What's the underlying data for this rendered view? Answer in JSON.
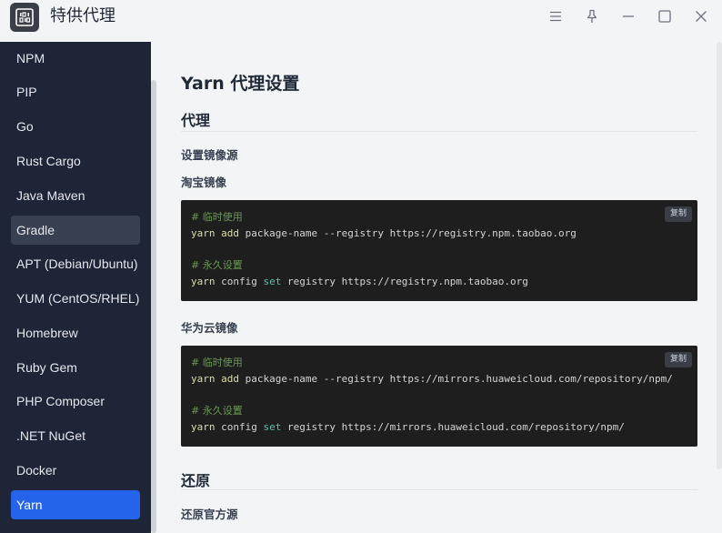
{
  "app": {
    "title": "特供代理"
  },
  "sidebar": {
    "items": [
      {
        "label": "NPM"
      },
      {
        "label": "PIP"
      },
      {
        "label": "Go"
      },
      {
        "label": "Rust Cargo"
      },
      {
        "label": "Java Maven"
      },
      {
        "label": "Gradle"
      },
      {
        "label": "APT (Debian/Ubuntu)"
      },
      {
        "label": "YUM (CentOS/RHEL)"
      },
      {
        "label": "Homebrew"
      },
      {
        "label": "Ruby Gem"
      },
      {
        "label": "PHP Composer"
      },
      {
        "label": ".NET NuGet"
      },
      {
        "label": "Docker"
      },
      {
        "label": "Yarn"
      }
    ],
    "hovered": "Gradle",
    "selected": "Yarn"
  },
  "main": {
    "page_title": "Yarn 代理设置",
    "proxy_section": {
      "title": "代理",
      "subtitle": "设置镜像源",
      "mirrors": [
        {
          "label": "淘宝镜像",
          "copy_label": "复制",
          "comment_temp": "# 临时使用",
          "cmd_temp": {
            "yarn": "yarn",
            "sub": "add",
            "rest": " package-name --registry https://registry.npm.taobao.org"
          },
          "comment_perm": "# 永久设置",
          "cmd_perm": {
            "yarn": "yarn",
            "sub": " config ",
            "set": "set",
            "rest": " registry https://registry.npm.taobao.org"
          }
        },
        {
          "label": "华为云镜像",
          "copy_label": "复制",
          "comment_temp": "# 临时使用",
          "cmd_temp": {
            "yarn": "yarn",
            "sub": "add",
            "rest": " package-name --registry https://mirrors.huaweicloud.com/repository/npm/"
          },
          "comment_perm": "# 永久设置",
          "cmd_perm": {
            "yarn": "yarn",
            "sub": " config ",
            "set": "set",
            "rest": " registry https://mirrors.huaweicloud.com/repository/npm/"
          }
        }
      ]
    },
    "restore_section": {
      "title": "还原",
      "subtitle": "还原官方源"
    }
  },
  "colors": {
    "sidebar_bg": "#1e2537",
    "accent": "#2563eb",
    "code_bg": "#1e1e1e",
    "comment": "#6a9955"
  },
  "icons": {
    "app": "binary-app-icon",
    "menu": "menu-icon",
    "pin": "pin-icon",
    "minimize": "minimize-icon",
    "maximize": "maximize-icon",
    "close": "close-icon"
  }
}
